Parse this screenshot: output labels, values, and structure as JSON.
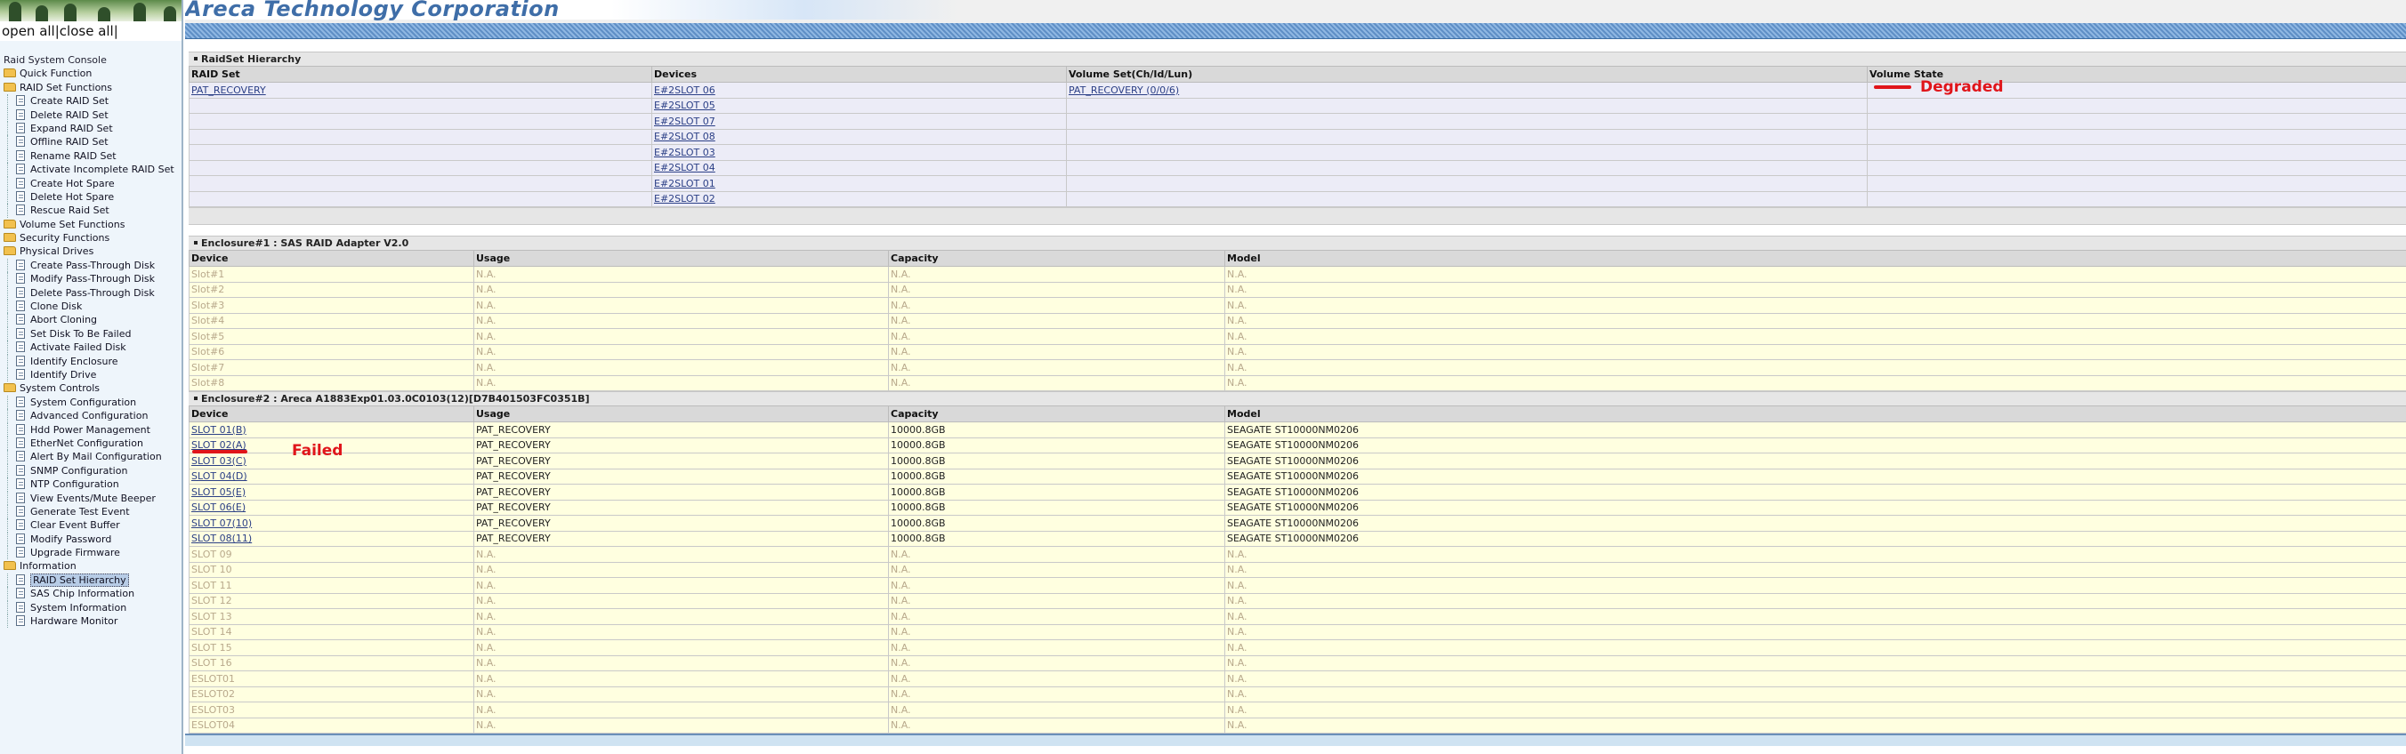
{
  "brand": {
    "title": "Areca Technology Corporation"
  },
  "left": {
    "open_all": "open all",
    "separator": "|",
    "close_all": "close all",
    "separator2": "|",
    "tree": [
      {
        "type": "root",
        "label": "Raid System Console"
      },
      {
        "type": "folder",
        "label": "Quick Function"
      },
      {
        "type": "folder",
        "label": "RAID Set Functions",
        "open": true
      },
      {
        "type": "leaf",
        "label": "Create RAID Set"
      },
      {
        "type": "leaf",
        "label": "Delete RAID Set"
      },
      {
        "type": "leaf",
        "label": "Expand RAID Set"
      },
      {
        "type": "leaf",
        "label": "Offline RAID Set"
      },
      {
        "type": "leaf",
        "label": "Rename RAID Set"
      },
      {
        "type": "leaf",
        "label": "Activate Incomplete RAID Set"
      },
      {
        "type": "leaf",
        "label": "Create Hot Spare"
      },
      {
        "type": "leaf",
        "label": "Delete Hot Spare"
      },
      {
        "type": "leaf",
        "label": "Rescue Raid Set"
      },
      {
        "type": "folder",
        "label": "Volume Set Functions"
      },
      {
        "type": "folder",
        "label": "Security Functions"
      },
      {
        "type": "folder",
        "label": "Physical Drives",
        "open": true
      },
      {
        "type": "leaf",
        "label": "Create Pass-Through Disk"
      },
      {
        "type": "leaf",
        "label": "Modify Pass-Through Disk"
      },
      {
        "type": "leaf",
        "label": "Delete Pass-Through Disk"
      },
      {
        "type": "leaf",
        "label": "Clone Disk"
      },
      {
        "type": "leaf",
        "label": "Abort Cloning"
      },
      {
        "type": "leaf",
        "label": "Set Disk To Be Failed"
      },
      {
        "type": "leaf",
        "label": "Activate Failed Disk"
      },
      {
        "type": "leaf",
        "label": "Identify Enclosure"
      },
      {
        "type": "leaf",
        "label": "Identify Drive"
      },
      {
        "type": "folder",
        "label": "System Controls",
        "open": true
      },
      {
        "type": "leaf",
        "label": "System Configuration"
      },
      {
        "type": "leaf",
        "label": "Advanced Configuration"
      },
      {
        "type": "leaf",
        "label": "Hdd Power Management"
      },
      {
        "type": "leaf",
        "label": "EtherNet Configuration"
      },
      {
        "type": "leaf",
        "label": "Alert By Mail Configuration"
      },
      {
        "type": "leaf",
        "label": "SNMP Configuration"
      },
      {
        "type": "leaf",
        "label": "NTP Configuration"
      },
      {
        "type": "leaf",
        "label": "View Events/Mute Beeper"
      },
      {
        "type": "leaf",
        "label": "Generate Test Event"
      },
      {
        "type": "leaf",
        "label": "Clear Event Buffer"
      },
      {
        "type": "leaf",
        "label": "Modify Password"
      },
      {
        "type": "leaf",
        "label": "Upgrade Firmware"
      },
      {
        "type": "folder",
        "label": "Information",
        "open": true
      },
      {
        "type": "leaf",
        "label": "RAID Set Hierarchy",
        "selected": true
      },
      {
        "type": "leaf",
        "label": "SAS Chip Information"
      },
      {
        "type": "leaf",
        "label": "System Information"
      },
      {
        "type": "leaf",
        "label": "Hardware Monitor"
      }
    ]
  },
  "raidset": {
    "title": "RaidSet Hierarchy",
    "headers": [
      "RAID Set",
      "Devices",
      "Volume Set(Ch/Id/Lun)",
      "Volume State"
    ],
    "rows": [
      [
        "PAT_RECOVERY",
        "E#2SLOT 06",
        "PAT_RECOVERY (0/0/6)",
        "Degraded"
      ],
      [
        "",
        "E#2SLOT 05",
        "",
        ""
      ],
      [
        "",
        "E#2SLOT 07",
        "",
        ""
      ],
      [
        "",
        "E#2SLOT 08",
        "",
        ""
      ],
      [
        "",
        "E#2SLOT 03",
        "",
        ""
      ],
      [
        "",
        "E#2SLOT 04",
        "",
        ""
      ],
      [
        "",
        "E#2SLOT 01",
        "",
        ""
      ],
      [
        "",
        "E#2SLOT 02",
        "",
        ""
      ]
    ]
  },
  "enclosure1": {
    "title": "Enclosure#1 : SAS RAID Adapter V2.0",
    "headers": [
      "Device",
      "Usage",
      "Capacity",
      "Model"
    ],
    "rows": [
      [
        "Slot#1",
        "N.A.",
        "N.A.",
        "N.A."
      ],
      [
        "Slot#2",
        "N.A.",
        "N.A.",
        "N.A."
      ],
      [
        "Slot#3",
        "N.A.",
        "N.A.",
        "N.A."
      ],
      [
        "Slot#4",
        "N.A.",
        "N.A.",
        "N.A."
      ],
      [
        "Slot#5",
        "N.A.",
        "N.A.",
        "N.A."
      ],
      [
        "Slot#6",
        "N.A.",
        "N.A.",
        "N.A."
      ],
      [
        "Slot#7",
        "N.A.",
        "N.A.",
        "N.A."
      ],
      [
        "Slot#8",
        "N.A.",
        "N.A.",
        "N.A."
      ]
    ]
  },
  "enclosure2": {
    "title": "Enclosure#2 : Areca A1883Exp01.03.0C0103(12)[D7B401503FC0351B]",
    "headers": [
      "Device",
      "Usage",
      "Capacity",
      "Model"
    ],
    "rows": [
      [
        "SLOT 01(B)",
        "PAT_RECOVERY",
        "10000.8GB",
        "SEAGATE ST10000NM0206",
        true
      ],
      [
        "SLOT 02(A)",
        "PAT_RECOVERY",
        "10000.8GB",
        "SEAGATE ST10000NM0206",
        true
      ],
      [
        "SLOT 03(C)",
        "PAT_RECOVERY",
        "10000.8GB",
        "SEAGATE ST10000NM0206",
        true
      ],
      [
        "SLOT 04(D)",
        "PAT_RECOVERY",
        "10000.8GB",
        "SEAGATE ST10000NM0206",
        true
      ],
      [
        "SLOT 05(E)",
        "PAT_RECOVERY",
        "10000.8GB",
        "SEAGATE ST10000NM0206",
        true
      ],
      [
        "SLOT 06(E)",
        "PAT_RECOVERY",
        "10000.8GB",
        "SEAGATE ST10000NM0206",
        true
      ],
      [
        "SLOT 07(10)",
        "PAT_RECOVERY",
        "10000.8GB",
        "SEAGATE ST10000NM0206",
        true
      ],
      [
        "SLOT 08(11)",
        "PAT_RECOVERY",
        "10000.8GB",
        "SEAGATE ST10000NM0206",
        true
      ],
      [
        "SLOT 09",
        "N.A.",
        "N.A.",
        "N.A.",
        false
      ],
      [
        "SLOT 10",
        "N.A.",
        "N.A.",
        "N.A.",
        false
      ],
      [
        "SLOT 11",
        "N.A.",
        "N.A.",
        "N.A.",
        false
      ],
      [
        "SLOT 12",
        "N.A.",
        "N.A.",
        "N.A.",
        false
      ],
      [
        "SLOT 13",
        "N.A.",
        "N.A.",
        "N.A.",
        false
      ],
      [
        "SLOT 14",
        "N.A.",
        "N.A.",
        "N.A.",
        false
      ],
      [
        "SLOT 15",
        "N.A.",
        "N.A.",
        "N.A.",
        false
      ],
      [
        "SLOT 16",
        "N.A.",
        "N.A.",
        "N.A.",
        false
      ],
      [
        "ESLOT01",
        "N.A.",
        "N.A.",
        "N.A.",
        false
      ],
      [
        "ESLOT02",
        "N.A.",
        "N.A.",
        "N.A.",
        false
      ],
      [
        "ESLOT03",
        "N.A.",
        "N.A.",
        "N.A.",
        false
      ],
      [
        "ESLOT04",
        "N.A.",
        "N.A.",
        "N.A.",
        false
      ]
    ]
  },
  "annotations": {
    "degraded": "Degraded",
    "failed": "Failed"
  },
  "colors": {
    "annotation_red": "#e0151a",
    "link_blue": "#2b3f86",
    "na_text": "#b9a98c"
  }
}
